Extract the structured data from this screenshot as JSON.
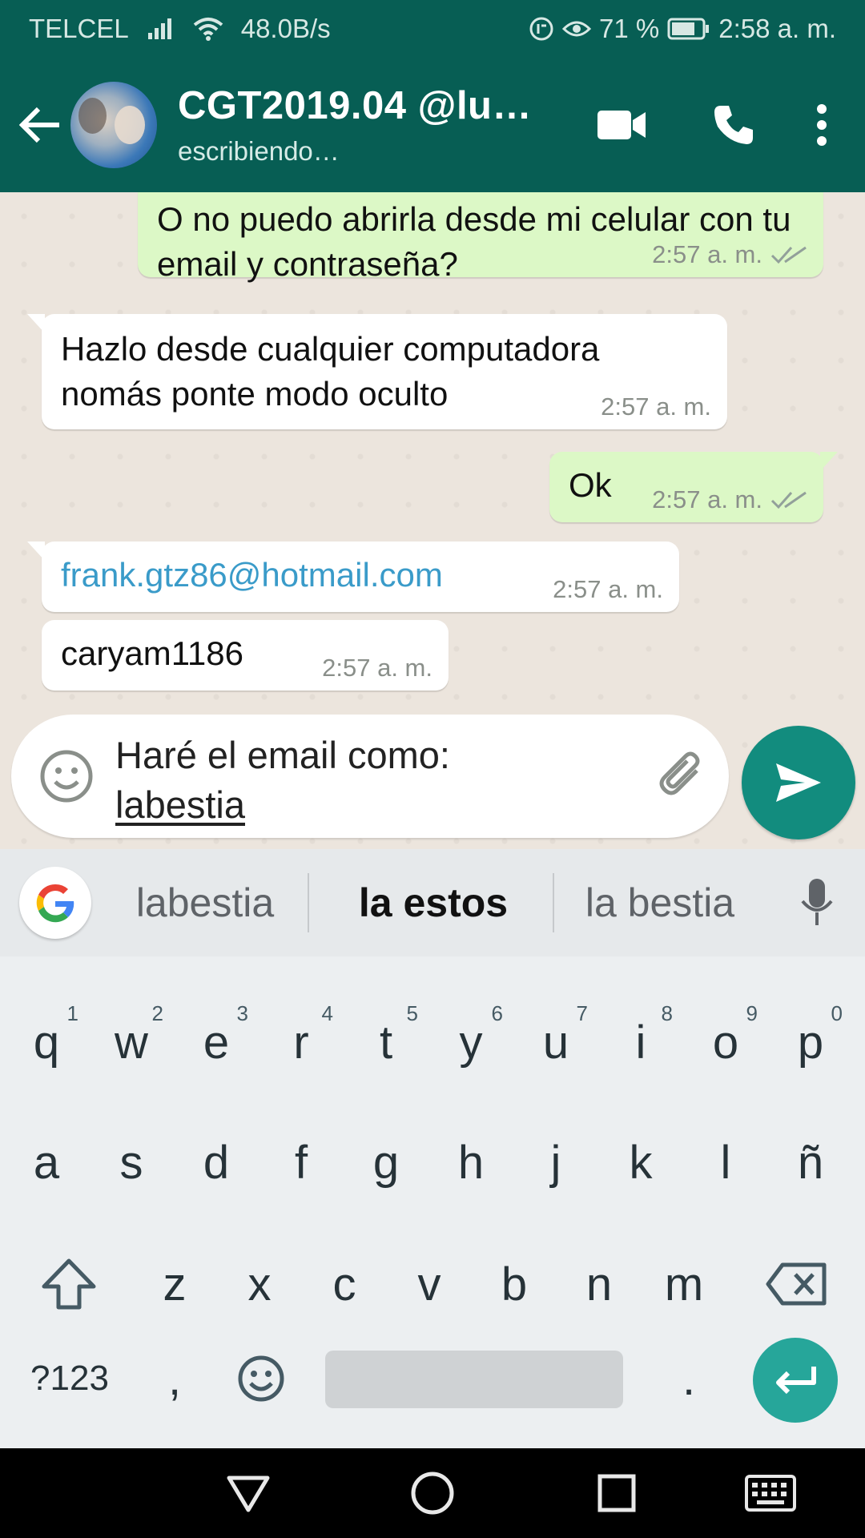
{
  "status_bar": {
    "carrier": "TELCEL",
    "net_speed": "48.0B/s",
    "battery": "71 %",
    "time": "2:58 a. m."
  },
  "header": {
    "title": "CGT2019.04 @lu…",
    "subtitle": "escribiendo…",
    "icons": [
      "back-arrow-icon",
      "video-call-icon",
      "phone-icon",
      "more-vert-icon"
    ]
  },
  "messages": [
    {
      "type": "out",
      "text": "O no puedo abrirla desde mi celular con tu email y contraseña?",
      "time": "2:57 a. m.",
      "read": true
    },
    {
      "type": "in",
      "text": "Hazlo desde cualquier computadora nomás ponte modo oculto",
      "time": "2:57 a. m."
    },
    {
      "type": "out",
      "text": "Ok",
      "time": "2:57 a. m.",
      "read": true
    },
    {
      "type": "in",
      "text": "frank.gtz86@hotmail.com",
      "time": "2:57 a. m.",
      "link": true
    },
    {
      "type": "in",
      "text": "caryam1186",
      "time": "2:57 a. m."
    }
  ],
  "compose": {
    "line1": "Haré el email como:",
    "line2": "labestia"
  },
  "keyboard": {
    "suggestions": [
      "labestia",
      "la estos",
      "la bestia"
    ],
    "row1": [
      {
        "k": "q",
        "h": "1"
      },
      {
        "k": "w",
        "h": "2"
      },
      {
        "k": "e",
        "h": "3"
      },
      {
        "k": "r",
        "h": "4"
      },
      {
        "k": "t",
        "h": "5"
      },
      {
        "k": "y",
        "h": "6"
      },
      {
        "k": "u",
        "h": "7"
      },
      {
        "k": "i",
        "h": "8"
      },
      {
        "k": "o",
        "h": "9"
      },
      {
        "k": "p",
        "h": "0"
      }
    ],
    "row2": [
      "a",
      "s",
      "d",
      "f",
      "g",
      "h",
      "j",
      "k",
      "l",
      "ñ"
    ],
    "row3": [
      "z",
      "x",
      "c",
      "v",
      "b",
      "n",
      "m"
    ],
    "row4": {
      "symbols": "?123",
      "comma": ",",
      "period": "."
    }
  },
  "colors": {
    "header": "#075e54",
    "outgoing_bubble": "#dcf8c6",
    "incoming_bubble": "#ffffff",
    "send_button": "#128c7e",
    "link": "#3a9bc9",
    "enter_key": "#26a69a"
  }
}
